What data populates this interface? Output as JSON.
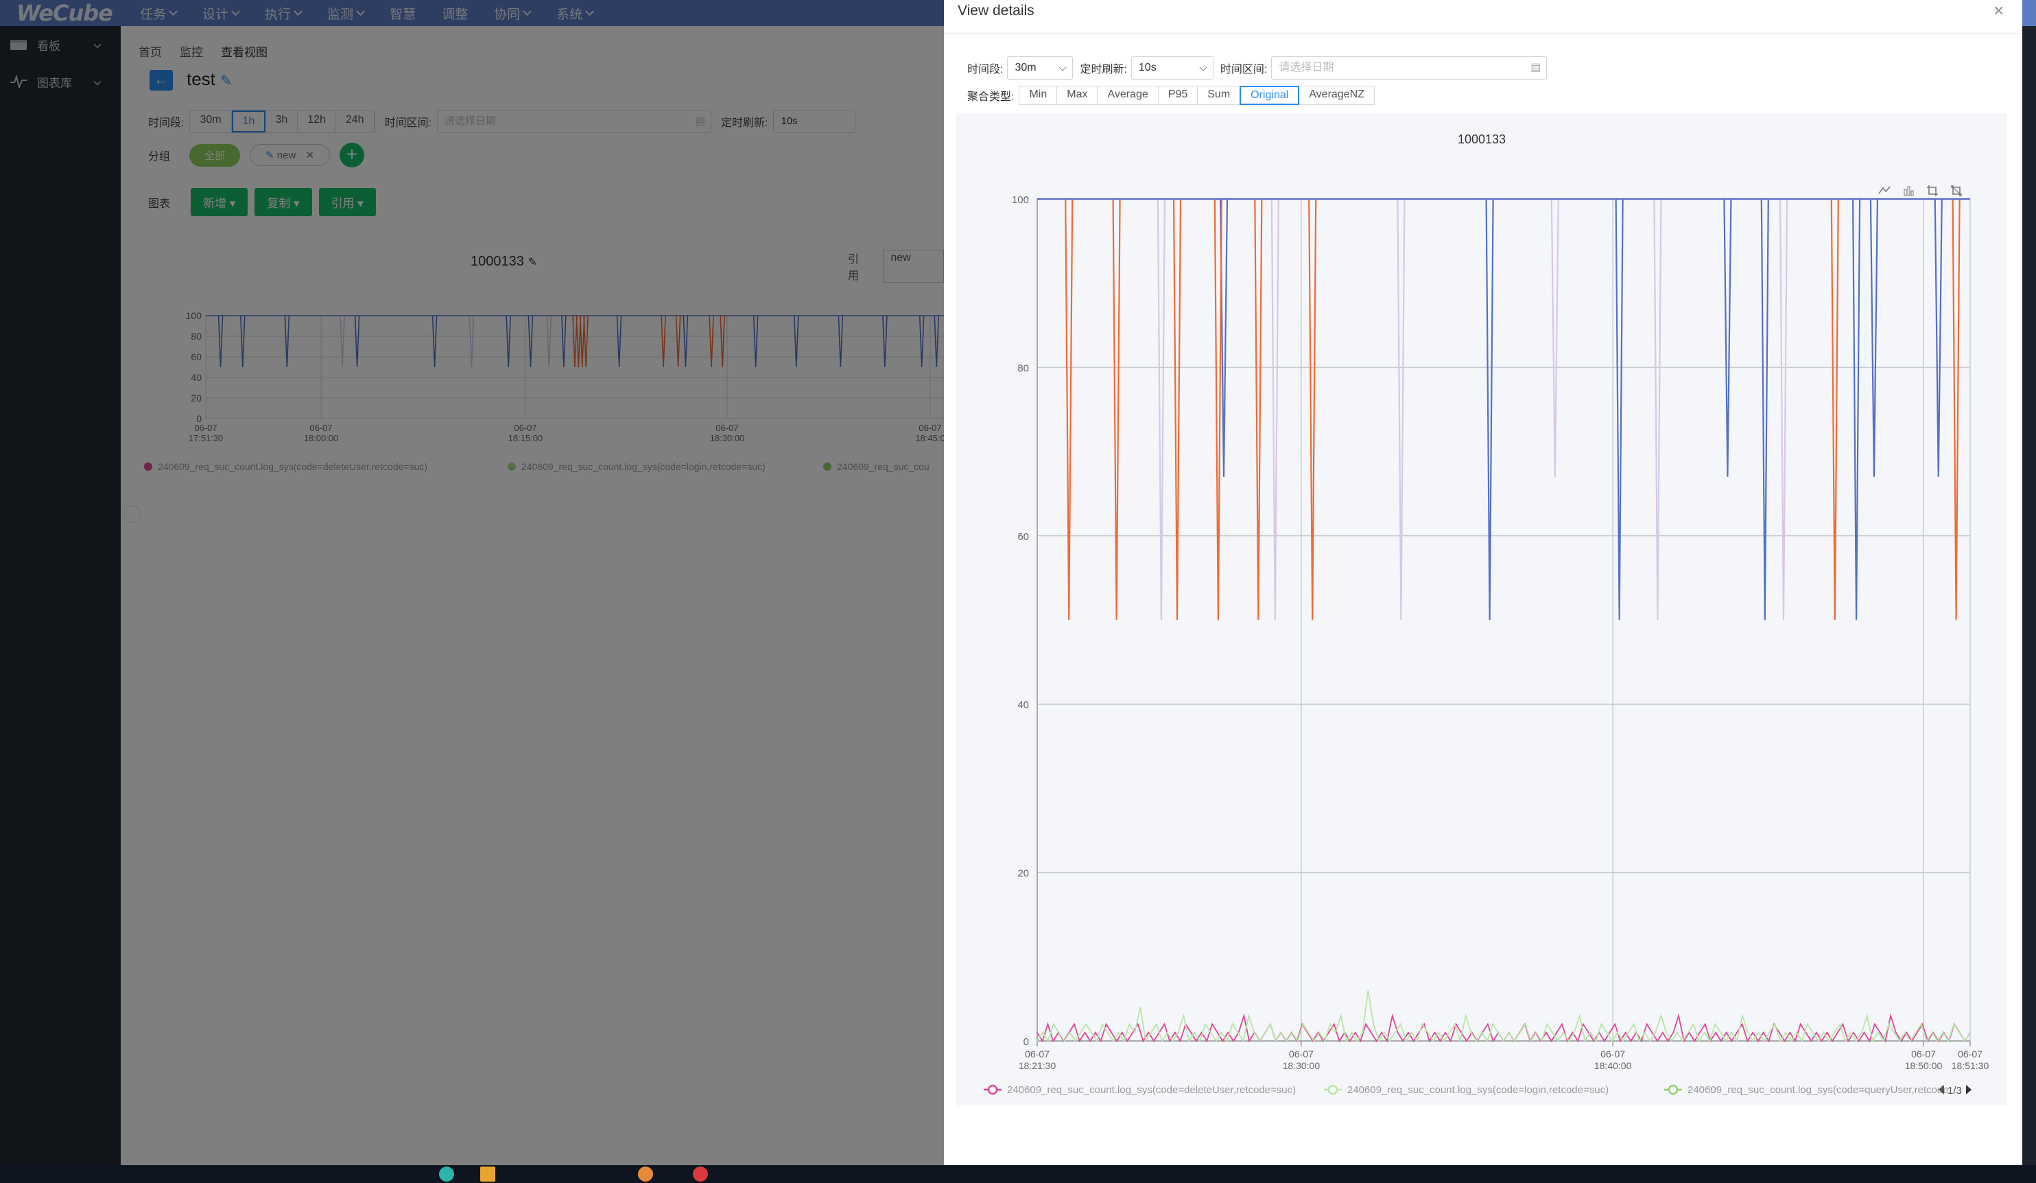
{
  "topbar": {
    "logo": "WeCube",
    "menu": [
      "任务",
      "设计",
      "执行",
      "监测",
      "智慧",
      "调整",
      "协同",
      "系统"
    ]
  },
  "sidebar": {
    "items": [
      {
        "label": "看板",
        "icon": "dashboard-icon"
      },
      {
        "label": "图表库",
        "icon": "pulse-icon"
      }
    ]
  },
  "main": {
    "breadcrumbs": [
      "首页",
      "监控",
      "查看视图"
    ],
    "title": "test",
    "time_label": "时间段:",
    "time_options": [
      "30m",
      "1h",
      "3h",
      "12h",
      "24h"
    ],
    "time_selected": "1h",
    "range_label": "时间区间:",
    "range_placeholder": "请选择日期",
    "refresh_label": "定时刷新:",
    "refresh_value": "10s",
    "group_label": "分组",
    "group_tags": [
      "全部",
      "new"
    ],
    "chart_label": "图表",
    "chart_buttons": [
      "新增",
      "复制",
      "引用"
    ],
    "mini_chart_title": "1000133",
    "mini_ref_label": "引用",
    "mini_ref_value": "new",
    "mini_yticks": [
      "100",
      "80",
      "60",
      "40",
      "20",
      "0"
    ],
    "mini_xticks": [
      [
        "06-07",
        "17:51:30"
      ],
      [
        "06-07",
        "18:00:00"
      ],
      [
        "06-07",
        "18:15:00"
      ],
      [
        "06-07",
        "18:30:00"
      ],
      [
        "06-07",
        "18:45:0"
      ]
    ],
    "mini_legend": [
      "240609_req_suc_count.log_sys(code=deleteUser,retcode=suc)",
      "240609_req_suc_count.log_sys(code=login,retcode=suc)",
      "240609_req_suc_cou"
    ]
  },
  "drawer": {
    "title": "View details",
    "time_label": "时间段:",
    "time_value": "30m",
    "refresh_label": "定时刷新:",
    "refresh_value": "10s",
    "range_label": "时间区间:",
    "range_placeholder": "请选择日期",
    "agg_label": "聚合类型:",
    "agg_options": [
      "Min",
      "Max",
      "Average",
      "P95",
      "Sum",
      "Original",
      "AverageNZ"
    ],
    "agg_selected": "Original",
    "legend_page": "1/3"
  },
  "colors": {
    "blue": "#5470c6",
    "orange": "#ee6b35",
    "lavender": "#d7c8e6",
    "pink": "#e0449a",
    "green": "#a5df8a"
  },
  "chart_data": {
    "type": "line",
    "title": "1000133",
    "xlabel": "",
    "ylabel": "",
    "ylim": [
      0,
      100
    ],
    "yticks": [
      0,
      20,
      40,
      60,
      80,
      100
    ],
    "x_ticks": [
      "06-07 18:21:30",
      "06-07 18:30:00",
      "06-07 18:40:00",
      "06-07 18:50:00",
      "06-07 18:51:30"
    ],
    "series": [
      {
        "name": "",
        "color": "#5470c6",
        "dips": [
          {
            "t": 0.2,
            "v": 67
          },
          {
            "t": 0.202,
            "v": 100
          },
          {
            "t": 0.485,
            "v": 50
          },
          {
            "t": 0.624,
            "v": 50
          },
          {
            "t": 0.74,
            "v": 67
          },
          {
            "t": 0.78,
            "v": 50
          },
          {
            "t": 0.878,
            "v": 50
          },
          {
            "t": 0.897,
            "v": 67
          },
          {
            "t": 0.966,
            "v": 67
          }
        ]
      },
      {
        "name": "",
        "color": "#ee6b35",
        "dips": [
          {
            "t": 0.034,
            "v": 50
          },
          {
            "t": 0.085,
            "v": 50
          },
          {
            "t": 0.15,
            "v": 50
          },
          {
            "t": 0.194,
            "v": 50
          },
          {
            "t": 0.237,
            "v": 50
          },
          {
            "t": 0.295,
            "v": 50
          },
          {
            "t": 0.855,
            "v": 50
          },
          {
            "t": 0.985,
            "v": 50
          }
        ]
      },
      {
        "name": "",
        "color": "#d7c8e6",
        "dips": [
          {
            "t": 0.133,
            "v": 50
          },
          {
            "t": 0.255,
            "v": 50
          },
          {
            "t": 0.39,
            "v": 50
          },
          {
            "t": 0.555,
            "v": 67
          },
          {
            "t": 0.665,
            "v": 50
          },
          {
            "t": 0.8,
            "v": 50
          }
        ]
      },
      {
        "name": "240609_req_suc_count.log_sys(code=deleteUser,retcode=suc)",
        "color": "#e0449a",
        "values": [
          1,
          0,
          2,
          0,
          1,
          0,
          1,
          2,
          0,
          1,
          0,
          1,
          0,
          2,
          1,
          0,
          1,
          0,
          1,
          2,
          0,
          1,
          0,
          1,
          2,
          0,
          1,
          0,
          2,
          1,
          0,
          1,
          0,
          2,
          1,
          0,
          1,
          0,
          1,
          3,
          0,
          1,
          0,
          1,
          2,
          0,
          1,
          0,
          1,
          0,
          2,
          1,
          0,
          1,
          0,
          1,
          2,
          0,
          1,
          0,
          1,
          0,
          2,
          1,
          0,
          1,
          0,
          3,
          1,
          0,
          1,
          0,
          1,
          2,
          0,
          1,
          0,
          1,
          0,
          2,
          1,
          0,
          1,
          0,
          1,
          2,
          0,
          1,
          0,
          1,
          0,
          1,
          2,
          0,
          1,
          0,
          1,
          0,
          1,
          2,
          0,
          1,
          0,
          2,
          1,
          0,
          1,
          0,
          1,
          2,
          0,
          1,
          0,
          1,
          0,
          2,
          1,
          0,
          1,
          0,
          1,
          3,
          0,
          1,
          0,
          1,
          2,
          0,
          1,
          0,
          1,
          0,
          1,
          2,
          0,
          1,
          0,
          1,
          0,
          2,
          1,
          0,
          1,
          0,
          2,
          1,
          0,
          1,
          0,
          1,
          0,
          1,
          2,
          0,
          1,
          0,
          1,
          0,
          2,
          1,
          0,
          3,
          1,
          0,
          1,
          0,
          1,
          2,
          0,
          1,
          0,
          1,
          0,
          2,
          1,
          0,
          1
        ]
      },
      {
        "name": "240609_req_suc_count.log_sys(code=login,retcode=suc)",
        "color": "#b8e6a6",
        "values": [
          0,
          1,
          0,
          2,
          1,
          0,
          1,
          0,
          1,
          2,
          1,
          0,
          2,
          1,
          0,
          1,
          0,
          2,
          1,
          4,
          0,
          1,
          2,
          0,
          1,
          0,
          1,
          3,
          0,
          1,
          0,
          2,
          1,
          0,
          1,
          0,
          2,
          1,
          0,
          3,
          1,
          0,
          1,
          2,
          0,
          1,
          0,
          1,
          0,
          2,
          1,
          0,
          1,
          0,
          2,
          1,
          3,
          0,
          1,
          0,
          1,
          6,
          2,
          0,
          1,
          0,
          1,
          2,
          0,
          1,
          0,
          2,
          1,
          0,
          1,
          0,
          1,
          2,
          0,
          3,
          1,
          0,
          1,
          0,
          2,
          1,
          0,
          1,
          0,
          1,
          2,
          0,
          1,
          0,
          2,
          1,
          0,
          1,
          0,
          1,
          3,
          0,
          1,
          0,
          2,
          1,
          0,
          1,
          0,
          1,
          2,
          0,
          1,
          0,
          1,
          3,
          1,
          0,
          1,
          0,
          1,
          2,
          0,
          1,
          0,
          2,
          1,
          0,
          1,
          0,
          3,
          1,
          0,
          1,
          0,
          1,
          2,
          0,
          1,
          0,
          1,
          0,
          2,
          1,
          0,
          1,
          0,
          1,
          2,
          0,
          1,
          0,
          1,
          3,
          0,
          1,
          0,
          2,
          1,
          0,
          1,
          0,
          1,
          2,
          0,
          1,
          0,
          1,
          0,
          2,
          1,
          0,
          1
        ]
      },
      {
        "name": "240609_req_suc_count.log_sys(code=queryUser,retcode",
        "color": "#8fd16e",
        "values": []
      }
    ]
  }
}
